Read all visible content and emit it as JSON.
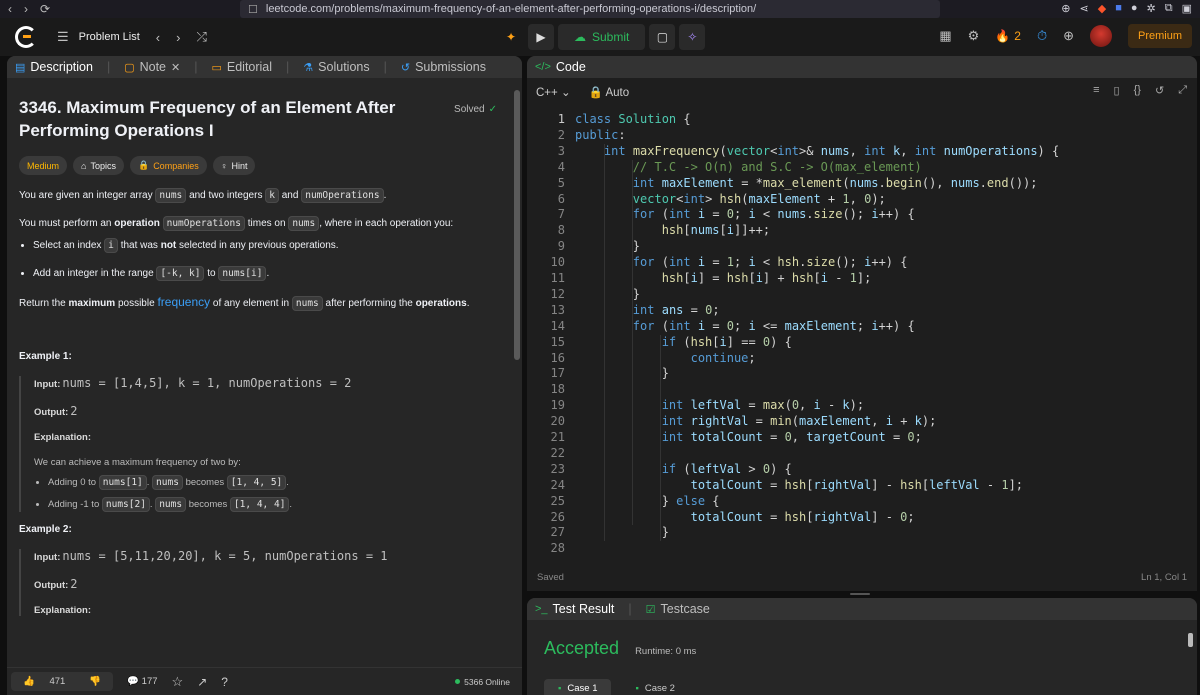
{
  "browser": {
    "url": "leetcode.com/problems/maximum-frequency-of-an-element-after-performing-operations-i/description/"
  },
  "appbar": {
    "problem_list": "Problem List",
    "submit": "Submit",
    "streak": "2",
    "premium": "Premium"
  },
  "left_tabs": [
    {
      "label": "Description"
    },
    {
      "label": "Note"
    },
    {
      "label": "Editorial"
    },
    {
      "label": "Solutions"
    },
    {
      "label": "Submissions"
    }
  ],
  "problem": {
    "title": "3346. Maximum Frequency of an Element After Performing Operations I",
    "status": "Solved",
    "difficulty": "Medium",
    "chips": [
      "Topics",
      "Companies",
      "Hint"
    ],
    "p1_a": "You are given an integer array",
    "p1_c1": "nums",
    "p1_b": "and two integers",
    "p1_c2": "k",
    "p1_and": "and",
    "p1_c3": "numOperations",
    "p1_end": ".",
    "p2_a": "You must perform an",
    "p2_bold": "operation",
    "p2_c1": "numOperations",
    "p2_b": "times on",
    "p2_c2": "nums",
    "p2_c": ", where in each operation you:",
    "b1_a": "Select an index",
    "b1_c": "i",
    "b1_b": "that was",
    "b1_bold": "not",
    "b1_d": "selected in any previous operations.",
    "b2_a": "Add an integer in the range",
    "b2_c1": "[-k, k]",
    "b2_b": "to",
    "b2_c2": "nums[i]",
    "b2_end": ".",
    "p3_a": "Return the",
    "p3_bold1": "maximum",
    "p3_b": "possible",
    "p3_freq": "frequency",
    "p3_c": "of any element in",
    "p3_code": "nums",
    "p3_d": "after performing the",
    "p3_bold2": "operations",
    "p3_end": "."
  },
  "examples": {
    "ex1_head": "Example 1:",
    "input_label": "Input:",
    "output_label": "Output:",
    "expl_label": "Explanation:",
    "ex1_input": "nums = [1,4,5], k = 1, numOperations = 2",
    "ex1_output": "2",
    "ex1_expl": "We can achieve a maximum frequency of two by:",
    "ex1_b1_a": "Adding 0 to",
    "ex1_b1_c1": "nums[1]",
    "ex1_b1_c2": "nums",
    "ex1_b1_b": "becomes",
    "ex1_b1_c3": "[1, 4, 5]",
    "ex1_b2_a": "Adding -1 to",
    "ex1_b2_c1": "nums[2]",
    "ex1_b2_c2": "nums",
    "ex1_b2_b": "becomes",
    "ex1_b2_c3": "[1, 4, 4]",
    "ex2_head": "Example 2:",
    "ex2_input": "nums = [5,11,20,20], k = 5, numOperations = 1",
    "ex2_output": "2"
  },
  "left_footer": {
    "likes": "471",
    "comments": "177",
    "online": "5366 Online"
  },
  "editor": {
    "tab": "Code",
    "language": "C++",
    "mode": "Auto",
    "saved": "Saved",
    "cursor": "Ln 1, Col 1",
    "lines": [
      "class Solution {",
      "public:",
      "    int maxFrequency(vector<int>& nums, int k, int numOperations) {",
      "        // T.C -> O(n) and S.C -> O(max_element)",
      "        int maxElement = *max_element(nums.begin(), nums.end());",
      "        vector<int> hsh(maxElement + 1, 0);",
      "        for (int i = 0; i < nums.size(); i++) {",
      "            hsh[nums[i]]++;",
      "        }",
      "        for (int i = 1; i < hsh.size(); i++) {",
      "            hsh[i] = hsh[i] + hsh[i - 1];",
      "        }",
      "        int ans = 0;",
      "        for (int i = 0; i <= maxElement; i++) {",
      "            if (hsh[i] == 0) {",
      "                continue;",
      "            }",
      "",
      "            int leftVal = max(0, i - k);",
      "            int rightVal = min(maxElement, i + k);",
      "            int totalCount = 0, targetCount = 0;",
      "",
      "            if (leftVal > 0) {",
      "                totalCount = hsh[rightVal] - hsh[leftVal - 1];",
      "            } else {",
      "                totalCount = hsh[rightVal] - 0;",
      "            }",
      ""
    ]
  },
  "result": {
    "tab1": "Test Result",
    "tab2": "Testcase",
    "status": "Accepted",
    "runtime": "Runtime: 0 ms",
    "cases": [
      "Case 1",
      "Case 2"
    ]
  },
  "colors": {
    "accent": "#ffa116",
    "green": "#2cbb5d",
    "link": "#3b9ef5"
  }
}
